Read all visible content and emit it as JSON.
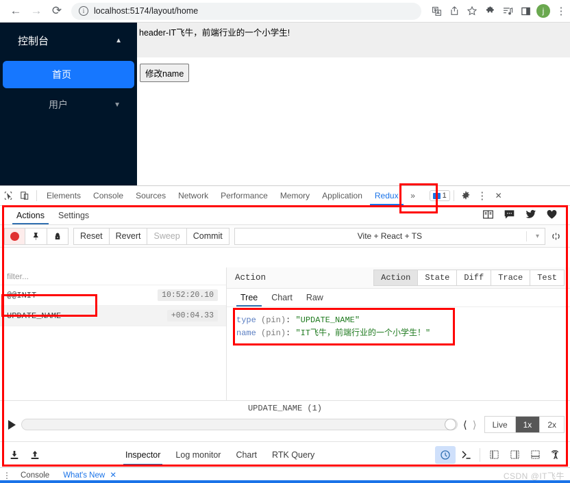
{
  "browser": {
    "back_icon": "arrow-left-icon",
    "forward_icon": "arrow-right-icon",
    "reload_icon": "reload-icon",
    "url": "localhost:5174/layout/home",
    "info_glyph": "i",
    "toolbar_icons": [
      "translate-icon",
      "share-icon",
      "bookmark-star-icon",
      "extensions-puzzle-icon",
      "media-list-icon",
      "side-panel-icon"
    ],
    "profile_initial": "j",
    "profile_color": "#6aa84f",
    "menu_icon": "kebab-menu-icon"
  },
  "page": {
    "sidebar": {
      "title": "控制台",
      "title_caret": "collapse-caret-up",
      "items": [
        {
          "label": "首页",
          "active": true
        },
        {
          "label": "用户",
          "active": false,
          "caret": "expand-caret-down"
        }
      ],
      "bg_color": "#001529",
      "active_color": "#1677ff"
    },
    "header_text": "header-IT飞牛，前端行业的一个小学生!",
    "modify_button": "修改name"
  },
  "devtools": {
    "left_icons": [
      "inspect-element-icon",
      "device-toolbar-icon"
    ],
    "tabs": [
      {
        "label": "Elements",
        "active": false
      },
      {
        "label": "Console",
        "active": false
      },
      {
        "label": "Sources",
        "active": false
      },
      {
        "label": "Network",
        "active": false
      },
      {
        "label": "Performance",
        "active": false
      },
      {
        "label": "Memory",
        "active": false
      },
      {
        "label": "Application",
        "active": false
      },
      {
        "label": "Redux",
        "active": true
      }
    ],
    "overflow_icon": "chevron-double-right-icon",
    "message_count": "1",
    "settings_icon": "gear-icon",
    "more_icon": "kebab-menu-icon",
    "close_icon": "close-icon"
  },
  "redux": {
    "tabs": [
      {
        "label": "Actions",
        "active": true
      },
      {
        "label": "Settings",
        "active": false
      }
    ],
    "social_icons": [
      "book-icon",
      "chat-icon",
      "twitter-icon",
      "heart-icon"
    ],
    "toolbar": {
      "record_icon": "record-dot-icon",
      "pin_icon": "pin-icon",
      "lock_icon": "lock-icon",
      "reset": "Reset",
      "revert": "Revert",
      "sweep": "Sweep",
      "commit": "Commit",
      "instance": "Vite + React + TS",
      "dropdown_icon": "chevron-down-icon",
      "refresh_icon": "refresh-icon"
    },
    "filter_placeholder": "filter...",
    "actions": [
      {
        "name": "@@INIT",
        "time": "10:52:20.10",
        "selected": false
      },
      {
        "name": "UPDATE_NAME",
        "time": "+00:04.33",
        "selected": true
      }
    ],
    "inspector": {
      "title": "Action",
      "segments": [
        {
          "label": "Action",
          "active": true
        },
        {
          "label": "State",
          "active": false
        },
        {
          "label": "Diff",
          "active": false
        },
        {
          "label": "Trace",
          "active": false
        },
        {
          "label": "Test",
          "active": false
        }
      ],
      "sub_tabs": [
        {
          "label": "Tree",
          "active": true
        },
        {
          "label": "Chart",
          "active": false
        },
        {
          "label": "Raw",
          "active": false
        }
      ],
      "tree": [
        {
          "key": "type",
          "pin": "(pin)",
          "value": "\"UPDATE_NAME\""
        },
        {
          "key": "name",
          "pin": "(pin)",
          "value": "\"IT飞牛，前端行业的一个小学生！\""
        }
      ]
    },
    "player": {
      "label": "UPDATE_NAME (1)",
      "play_icon": "play-icon",
      "prev_icon": "chevron-left-icon",
      "next_icon": "chevron-right-icon",
      "speeds": [
        {
          "label": "Live",
          "active": false
        },
        {
          "label": "1x",
          "active": true
        },
        {
          "label": "2x",
          "active": false
        }
      ]
    },
    "bottom": {
      "import_icon": "import-icon",
      "export_icon": "export-icon",
      "tabs": [
        {
          "label": "Inspector",
          "active": true
        },
        {
          "label": "Log monitor",
          "active": false
        },
        {
          "label": "Chart",
          "active": false
        },
        {
          "label": "RTK Query",
          "active": false
        }
      ],
      "right_icons": [
        "slider-monitor-icon",
        "console-prompt-icon",
        "dock-left-icon",
        "dock-right-icon",
        "dock-bottom-icon",
        "broadcast-icon"
      ]
    }
  },
  "drawer": {
    "menu_icon": "kebab-menu-icon",
    "tabs": [
      {
        "label": "Console",
        "active": false
      },
      {
        "label": "What's New",
        "active": true,
        "close_icon": "close-icon"
      }
    ],
    "watermark": "CSDN @IT飞牛"
  },
  "annotation_color": "#ff0000"
}
